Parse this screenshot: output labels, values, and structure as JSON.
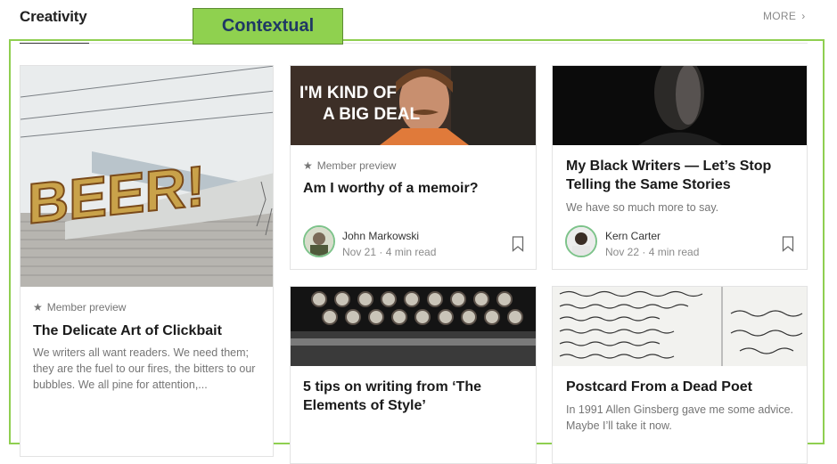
{
  "section": {
    "title": "Creativity",
    "more_label": "MORE",
    "more_chevron": "›"
  },
  "annotation": {
    "label": "Contextual",
    "color": "#8fd14f"
  },
  "cards": [
    {
      "image_text": "BEER!",
      "member_label": "Member preview",
      "title": "The Delicate Art of Clickbait",
      "excerpt": "We writers all want readers. We need them; they are the fuel to our fires, the bitters to our bubbles. We all pine for attention,..."
    },
    {
      "image_text_1": "I'M KIND OF",
      "image_text_2": "A BIG DEAL",
      "member_label": "Member preview",
      "title": "Am I worthy of a memoir?",
      "author": "John Markowski",
      "date": "Nov 21",
      "read_time": "4 min read"
    },
    {
      "title": "My Black Writers — Let’s Stop Telling the Same Stories",
      "subtitle": "We have so much more to say.",
      "author": "Kern Carter",
      "date": "Nov 22",
      "read_time": "4 min read"
    },
    {
      "title": "5 tips on writing from ‘The Elements of Style’"
    },
    {
      "title": "Postcard From a Dead Poet",
      "subtitle": "In 1991 Allen Ginsberg gave me some advice. Maybe I’ll take it now."
    }
  ],
  "colors": {
    "accent_green": "#8fcf50",
    "avatar_ring": "#7dc38a",
    "tag_text": "#1f3864"
  }
}
